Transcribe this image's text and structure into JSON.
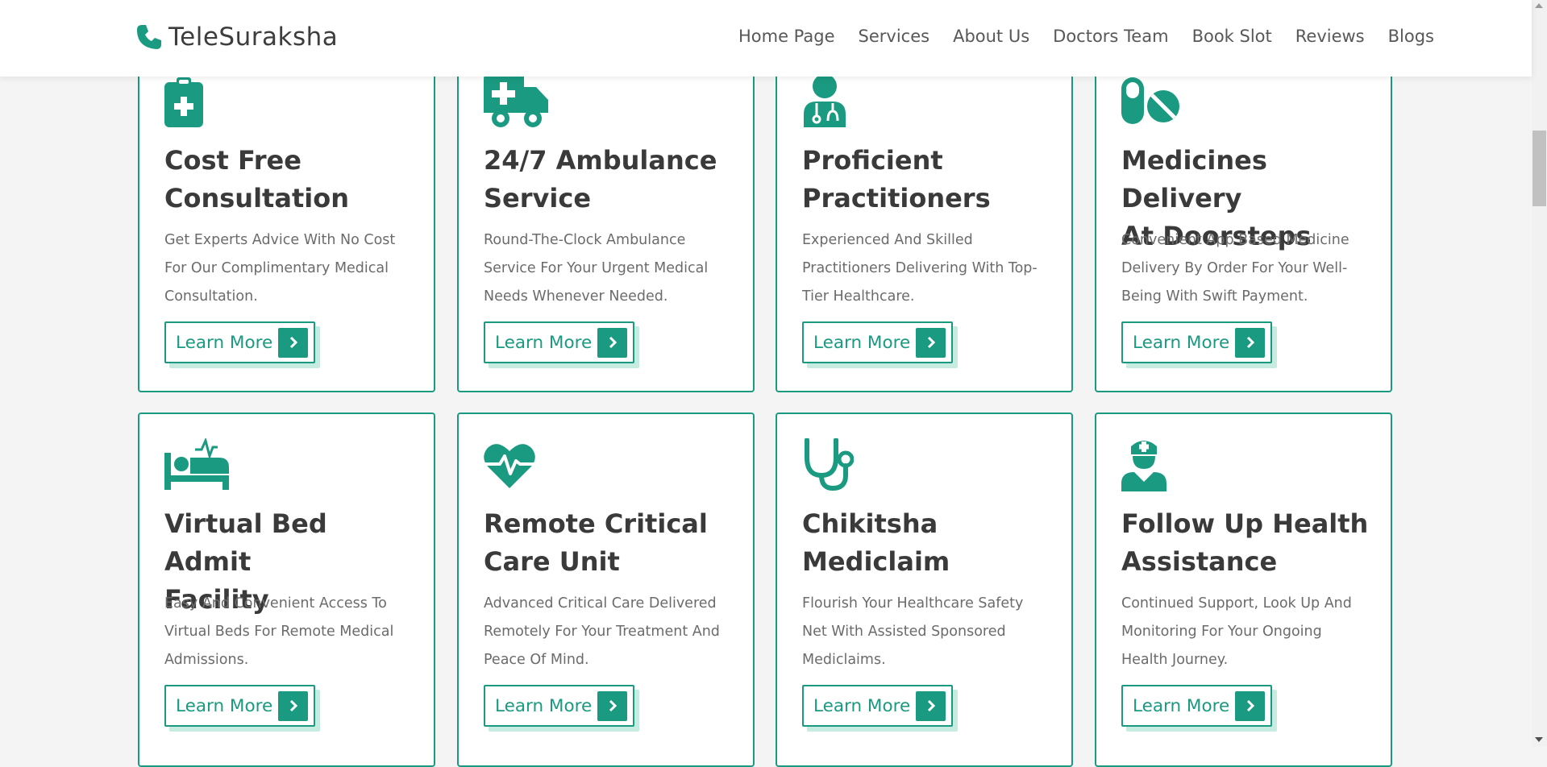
{
  "brand": {
    "name": "TeleSuraksha",
    "icon": "phone-icon",
    "color": "#1a9a80"
  },
  "nav": [
    {
      "label": "Home Page"
    },
    {
      "label": "Services"
    },
    {
      "label": "About Us"
    },
    {
      "label": "Doctors Team"
    },
    {
      "label": "Book Slot"
    },
    {
      "label": "Reviews"
    },
    {
      "label": "Blogs"
    }
  ],
  "theme": {
    "accent": "#1a9a80",
    "shadow": "#c6ebe1",
    "background": "#f4f4f4"
  },
  "cards": [
    {
      "icon": "clipboard-medical-icon",
      "title_line1": "Cost Free",
      "title_line2": "Consultation",
      "desc_line1": "Get Experts Advice With No Cost",
      "desc_line2": "For Our Complimentary Medical",
      "desc_line3": "Consultation.",
      "button": "Learn More"
    },
    {
      "icon": "ambulance-icon",
      "title_line1": "24/7 Ambulance",
      "title_line2": "Service",
      "desc_line1": "Round-The-Clock Ambulance",
      "desc_line2": "Service For Your Urgent Medical",
      "desc_line3": "Needs Whenever Needed.",
      "button": "Learn More"
    },
    {
      "icon": "doctor-icon",
      "title_line1": "Proficient",
      "title_line2": "Practitioners",
      "desc_line1": "Experienced And Skilled",
      "desc_line2": "Practitioners Delivering With Top-",
      "desc_line3": "Tier Healthcare.",
      "button": "Learn More"
    },
    {
      "icon": "pills-icon",
      "title_line1": "Medicines Delivery",
      "title_line2": "At Doorsteps",
      "desc_line1": "Convenient App Based Medicine",
      "desc_line2": "Delivery By Order For Your Well-",
      "desc_line3": "Being With Swift Payment.",
      "button": "Learn More"
    },
    {
      "icon": "hospital-bed-icon",
      "title_line1": "Virtual Bed Admit",
      "title_line2": "Facility",
      "desc_line1": "Easy And Convenient Access To",
      "desc_line2": "Virtual Beds For Remote Medical",
      "desc_line3": "Admissions.",
      "button": "Learn More"
    },
    {
      "icon": "heart-pulse-icon",
      "title_line1": "Remote Critical",
      "title_line2": "Care Unit",
      "desc_line1": "Advanced Critical Care Delivered",
      "desc_line2": "Remotely For Your Treatment And",
      "desc_line3": "Peace Of Mind.",
      "button": "Learn More"
    },
    {
      "icon": "stethoscope-icon",
      "title_line1": "Chikitsha",
      "title_line2": "Mediclaim",
      "desc_line1": "Flourish Your Healthcare Safety",
      "desc_line2": "Net With Assisted Sponsored",
      "desc_line3": "Mediclaims.",
      "button": "Learn More"
    },
    {
      "icon": "nurse-icon",
      "title_line1": "Follow Up Health",
      "title_line2": "Assistance",
      "desc_line1": "Continued Support, Look Up And",
      "desc_line2": "Monitoring For Your Ongoing",
      "desc_line3": "Health Journey.",
      "button": "Learn More"
    }
  ]
}
